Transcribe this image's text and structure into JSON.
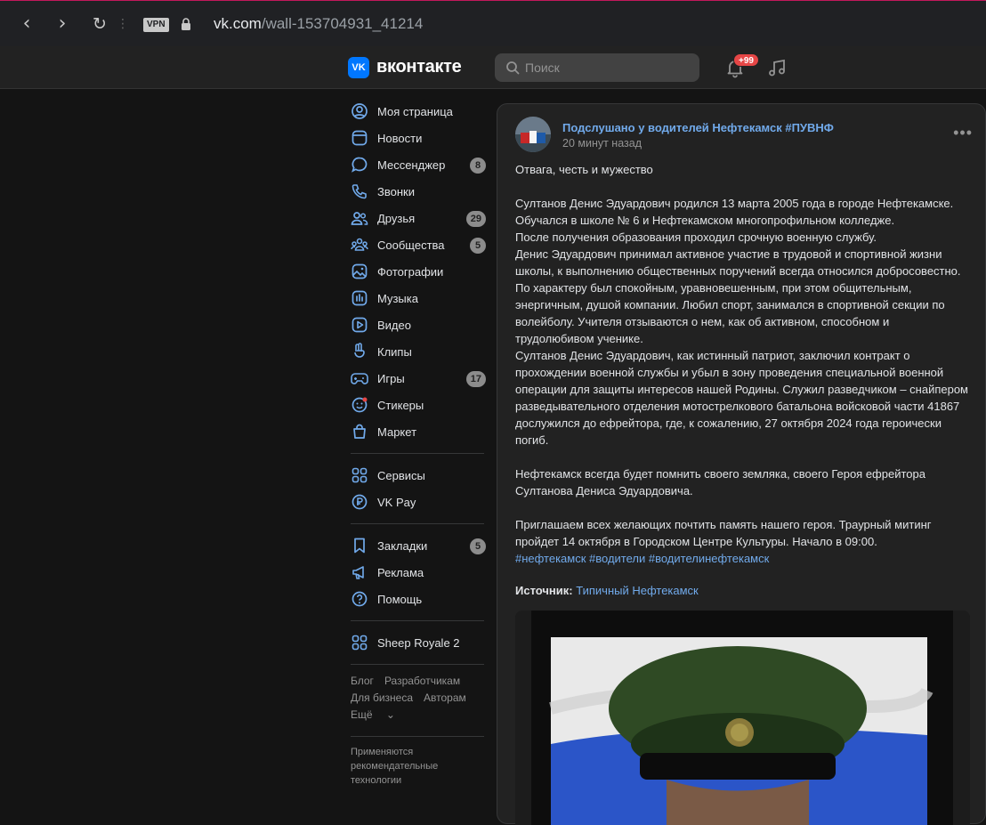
{
  "browser": {
    "vpn": "VPN",
    "url_host": "vk.com",
    "url_path": "/wall-153704931_41214"
  },
  "header": {
    "logo_letter": "VK",
    "brand": "вконтакте",
    "search_placeholder": "Поиск",
    "notifications_badge": "+99"
  },
  "sidebar": {
    "items": [
      {
        "label": "Моя страница",
        "icon": "user-circle-icon"
      },
      {
        "label": "Новости",
        "icon": "news-icon"
      },
      {
        "label": "Мессенджер",
        "icon": "message-icon",
        "count": "8"
      },
      {
        "label": "Звонки",
        "icon": "phone-icon"
      },
      {
        "label": "Друзья",
        "icon": "friends-icon",
        "count": "29"
      },
      {
        "label": "Сообщества",
        "icon": "communities-icon",
        "count": "5"
      },
      {
        "label": "Фотографии",
        "icon": "photo-icon"
      },
      {
        "label": "Музыка",
        "icon": "music-icon"
      },
      {
        "label": "Видео",
        "icon": "video-icon"
      },
      {
        "label": "Клипы",
        "icon": "clips-icon"
      },
      {
        "label": "Игры",
        "icon": "gamepad-icon",
        "count": "17"
      },
      {
        "label": "Стикеры",
        "icon": "sticker-icon"
      },
      {
        "label": "Маркет",
        "icon": "bag-icon"
      }
    ],
    "items2": [
      {
        "label": "Сервисы",
        "icon": "services-icon"
      },
      {
        "label": "VK Pay",
        "icon": "vkpay-icon"
      }
    ],
    "items3": [
      {
        "label": "Закладки",
        "icon": "bookmark-icon",
        "count": "5"
      },
      {
        "label": "Реклама",
        "icon": "megaphone-icon"
      },
      {
        "label": "Помощь",
        "icon": "help-icon"
      }
    ],
    "items4": [
      {
        "label": "Sheep Royale 2",
        "icon": "app-icon"
      }
    ],
    "footer": {
      "blog": "Блог",
      "developers": "Разработчикам",
      "business": "Для бизнеса",
      "authors": "Авторам",
      "more": "Ещё"
    },
    "reco": "Применяются рекомендательные технологии"
  },
  "post": {
    "author": "Подслушано у водителей Нефтекамск #ПУВНФ",
    "time": "20 минут назад",
    "text": "Отвага, честь и мужество\n\nСултанов Денис Эдуардович родился 13 марта 2005 года в городе Нефтекамске. Обучался в школе № 6 и Нефтекамском многопрофильном колледже.\nПосле получения образования проходил срочную военную службу.\nДенис Эдуардович принимал активное участие в трудовой и спортивной жизни школы, к выполнению общественных поручений всегда относился добросовестно. По характеру был спокойным, уравновешенным, при этом общительным, энергичным, душой компании. Любил спорт, занимался в спортивной секции по волейболу. Учителя отзываются о нем, как об активном, способном и трудолюбивом ученике.\nСултанов Денис Эдуардович, как истинный патриот, заключил контракт о прохождении военной службы и убыл в зону проведения специальной военной операции для защиты интересов нашей Родины. Служил разведчиком – снайпером разведывательного отделения мотострелкового батальона войсковой части 41867 дослужился до ефрейтора, где, к сожалению, 27 октября 2024 года героически погиб.\n\nНефтекамск всегда будет помнить своего земляка, своего Героя ефрейтора Султанова Дениса Эдуардовича.\n\nПриглашаем всех желающих почтить память нашего героя. Траурный митинг пройдет 14 октября в Городском Центре Культуры. Начало в 09:00.",
    "hashtags": "#нефтекамск #водители #водителинефтекамск",
    "source_label": "Источник:",
    "source_link": "Типичный Нефтекамск"
  },
  "colors": {
    "accent": "#0077ff",
    "link": "#71aaeb",
    "badge": "#e64646"
  }
}
